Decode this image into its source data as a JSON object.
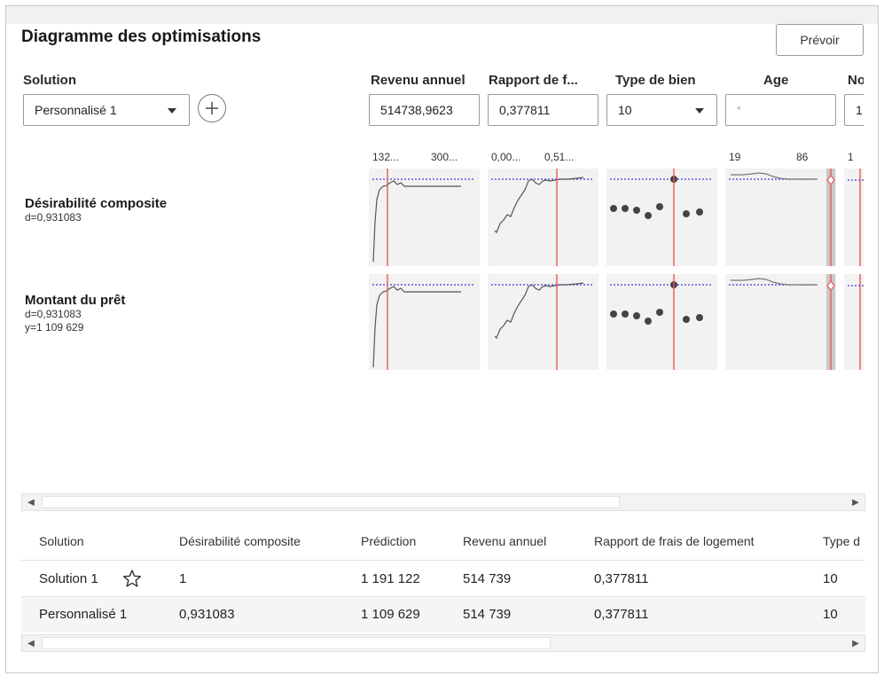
{
  "title": "Diagramme des optimisations",
  "predict_button": "Prévoir",
  "solution_label": "Solution",
  "solution_select": "Personnalisé 1",
  "add_icon": "plus-circle-icon",
  "factors": [
    {
      "header": "Revenu annuel",
      "value": "514738,9623",
      "type": "input",
      "tick_lo": "132...",
      "tick_hi": "300..."
    },
    {
      "header": "Rapport de f...",
      "value": "0,377811",
      "type": "input",
      "tick_lo": "0,00...",
      "tick_hi": "0,51..."
    },
    {
      "header": "Type de bien",
      "value": "10",
      "type": "select",
      "tick_lo": "",
      "tick_hi": ""
    },
    {
      "header": "Age",
      "value": "*",
      "type": "input",
      "tick_lo": "19",
      "tick_hi": "86"
    },
    {
      "header": "No",
      "value": "1",
      "type": "input",
      "tick_lo": "1",
      "tick_hi": ""
    }
  ],
  "rows": [
    {
      "title": "Désirabilité composite",
      "line1": "d=0,931083",
      "line2": ""
    },
    {
      "title": "Montant du prêt",
      "line1": "d=0,931083",
      "line2": "y=1 109 629"
    }
  ],
  "table": {
    "headers": [
      "Solution",
      "Désirabilité composite",
      "Prédiction",
      "Revenu annuel",
      "Rapport de frais de logement",
      "Type d"
    ],
    "rows": [
      {
        "solution": "Solution 1",
        "desir": "1",
        "pred": "1 191 122",
        "revenu": "514 739",
        "rapport": "0,377811",
        "type": "10",
        "starred": true
      },
      {
        "solution": "Personnalisé 1",
        "desir": "0,931083",
        "pred": "1 109 629",
        "revenu": "514 739",
        "rapport": "0,377811",
        "type": "10",
        "starred": false
      }
    ]
  },
  "colors": {
    "current_line": "#e8585a",
    "target_line": "#3b3bd9",
    "curve": "#555555",
    "point": "#444444"
  }
}
